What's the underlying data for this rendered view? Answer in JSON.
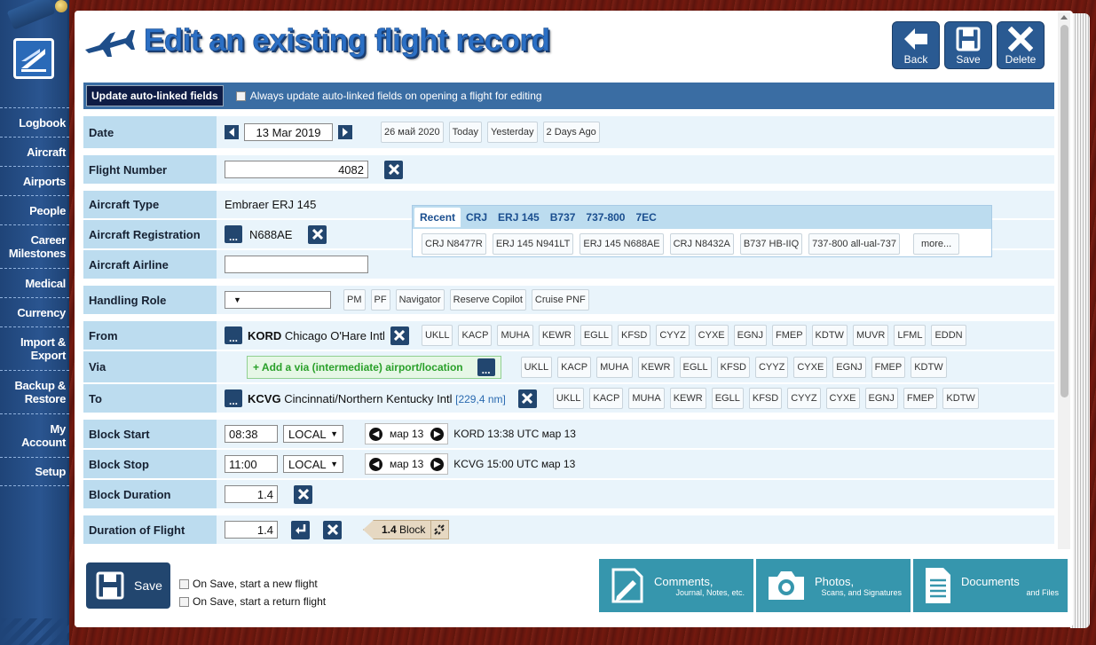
{
  "sidebar": {
    "items": [
      {
        "label": "Logbook"
      },
      {
        "label": "Aircraft"
      },
      {
        "label": "Airports"
      },
      {
        "label": "People"
      },
      {
        "label": "Career\nMilestones"
      },
      {
        "label": "Medical"
      },
      {
        "label": "Currency"
      },
      {
        "label": "Import &\nExport"
      },
      {
        "label": "Backup &\nRestore"
      },
      {
        "label": "My\nAccount"
      },
      {
        "label": "Setup"
      }
    ]
  },
  "header": {
    "title": "Edit an existing flight record",
    "buttons": {
      "back": "Back",
      "save": "Save",
      "delete": "Delete"
    }
  },
  "auto_bar": {
    "button": "Update auto-linked fields",
    "checkbox_label": "Always update auto-linked fields on opening a flight for editing"
  },
  "form": {
    "date": {
      "label": "Date",
      "value": "13 Mar 2019",
      "quick": [
        "26 май 2020",
        "Today",
        "Yesterday",
        "2 Days Ago"
      ]
    },
    "flight_number": {
      "label": "Flight Number",
      "value": "4082"
    },
    "aircraft_type": {
      "label": "Aircraft Type",
      "value": "Embraer ERJ 145"
    },
    "aircraft_registration": {
      "label": "Aircraft Registration",
      "value": "N688AE"
    },
    "aircraft_airline": {
      "label": "Aircraft Airline",
      "value": ""
    },
    "recent": {
      "tabs": [
        "Recent",
        "CRJ",
        "ERJ 145",
        "B737",
        "737-800",
        "7EC"
      ],
      "items": [
        "CRJ N8477R",
        "ERJ 145 N941LT",
        "ERJ 145 N688AE",
        "CRJ N8432A",
        "B737 HB-IIQ",
        "737-800 all-ual-737",
        "more..."
      ]
    },
    "handling_role": {
      "label": "Handling Role",
      "value": "",
      "options": [
        "PM",
        "PF",
        "Navigator",
        "Reserve Copilot",
        "Cruise PNF"
      ]
    },
    "from": {
      "label": "From",
      "code": "KORD",
      "name": "Chicago O'Hare Intl",
      "quick": [
        "UKLL",
        "KACP",
        "MUHA",
        "KEWR",
        "EGLL",
        "KFSD",
        "CYYZ",
        "CYXE",
        "EGNJ",
        "FMEP",
        "KDTW",
        "MUVR",
        "LFML",
        "EDDN"
      ]
    },
    "via": {
      "label": "Via",
      "add_label": "+ Add a via (intermediate) airport/location",
      "quick": [
        "UKLL",
        "KACP",
        "MUHA",
        "KEWR",
        "EGLL",
        "KFSD",
        "CYYZ",
        "CYXE",
        "EGNJ",
        "FMEP",
        "KDTW"
      ]
    },
    "to": {
      "label": "To",
      "code": "KCVG",
      "name": "Cincinnati/Northern Kentucky Intl",
      "distance": "[229,4 nm]",
      "quick": [
        "UKLL",
        "KACP",
        "MUHA",
        "KEWR",
        "EGLL",
        "KFSD",
        "CYYZ",
        "CYXE",
        "EGNJ",
        "FMEP",
        "KDTW"
      ]
    },
    "block_start": {
      "label": "Block Start",
      "time": "08:38",
      "zone": "LOCAL",
      "day": "мар 13",
      "utc": "KORD 13:38 UTC мар 13"
    },
    "block_stop": {
      "label": "Block Stop",
      "time": "11:00",
      "zone": "LOCAL",
      "day": "мар 13",
      "utc": "KCVG 15:00 UTC мар 13"
    },
    "block_duration": {
      "label": "Block Duration",
      "value": "1.4"
    },
    "duration_of_flight": {
      "label": "Duration of Flight",
      "value": "1.4",
      "tag_value": "1.4",
      "tag_unit": "Block"
    }
  },
  "bottom": {
    "save": "Save",
    "opt_new": "On Save, start a new flight",
    "opt_return": "On Save, start a return flight",
    "panels": [
      {
        "title": "Comments,",
        "sub": "Journal, Notes, etc."
      },
      {
        "title": "Photos,",
        "sub": "Scans, and Signatures"
      },
      {
        "title": "Documents",
        "sub": "and Files"
      }
    ]
  },
  "colors": {
    "accent": "#2b6fc4",
    "navy": "#22466f",
    "label_bg": "#bcdcef",
    "row_bg": "#e9f4fb",
    "panel_btn": "#3696ad"
  }
}
